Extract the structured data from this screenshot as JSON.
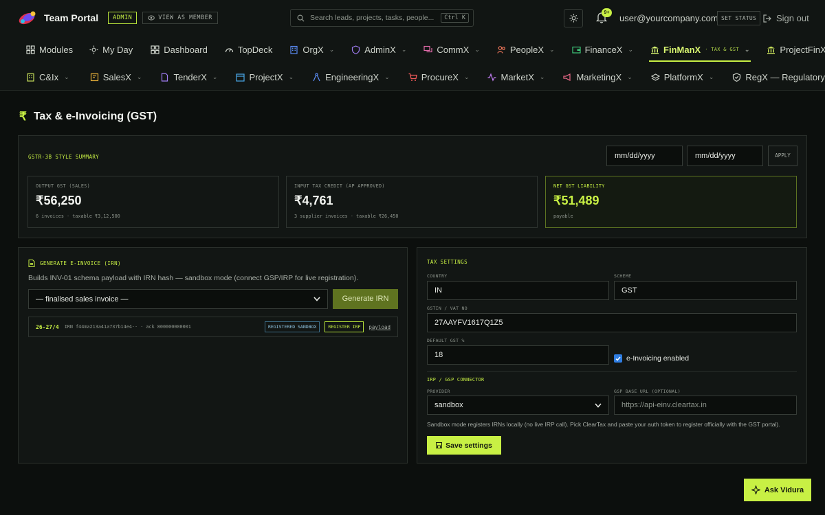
{
  "header": {
    "brand_name": "Team Portal",
    "admin_badge": "ADMIN",
    "view_as_member": "VIEW AS MEMBER",
    "search_placeholder": "Search leads, projects, tasks, people...",
    "search_shortcut": "Ctrl K",
    "notification_count": "9+",
    "user_email": "user@yourcompany.com",
    "set_status": "SET STATUS",
    "sign_out": "Sign out"
  },
  "nav_primary": [
    {
      "label": "Modules",
      "icon": "grid-icon"
    },
    {
      "label": "My Day",
      "icon": "sun-icon"
    },
    {
      "label": "Dashboard",
      "icon": "grid-icon"
    },
    {
      "label": "TopDeck",
      "icon": "gauge-icon"
    },
    {
      "label": "OrgX",
      "icon": "building-icon"
    },
    {
      "label": "AdminX",
      "icon": "shield-icon"
    },
    {
      "label": "CommX",
      "icon": "chat-icon"
    },
    {
      "label": "PeopleX",
      "icon": "people-icon"
    },
    {
      "label": "FinanceX",
      "icon": "wallet-icon"
    },
    {
      "label": "FinManX",
      "sub": "· TAX & GST",
      "icon": "bank-icon",
      "active": true
    },
    {
      "label": "ProjectFinX",
      "icon": "bank-icon"
    }
  ],
  "nav_secondary": [
    {
      "label": "C&Ix",
      "icon": "building-icon"
    },
    {
      "label": "SalesX",
      "icon": "tag-icon"
    },
    {
      "label": "TenderX",
      "icon": "file-icon"
    },
    {
      "label": "ProjectX",
      "icon": "calendar-icon"
    },
    {
      "label": "EngineeringX",
      "icon": "compass-icon"
    },
    {
      "label": "ProcureX",
      "icon": "cart-icon"
    },
    {
      "label": "MarketX",
      "icon": "pulse-icon"
    },
    {
      "label": "MarketingX",
      "icon": "megaphone-icon"
    },
    {
      "label": "PlatformX",
      "icon": "layers-icon"
    },
    {
      "label": "RegX — Regulatory",
      "icon": "shield-icon"
    }
  ],
  "page": {
    "title": "Tax & e-Invoicing (GST)",
    "title_icon": "rupee-icon"
  },
  "summary": {
    "heading": "GSTR-3B STYLE SUMMARY",
    "from_date": "mm/dd/yyyy",
    "to_date": "mm/dd/yyyy",
    "apply": "APPLY",
    "cards": [
      {
        "label": "OUTPUT GST (SALES)",
        "amount": "₹56,250",
        "sub": "6 invoices · taxable ₹3,12,500"
      },
      {
        "label": "INPUT TAX CREDIT (AP APPROVED)",
        "amount": "₹4,761",
        "sub": "3 supplier invoices · taxable ₹26,450"
      },
      {
        "label": "NET GST LIABILITY",
        "amount": "₹51,489",
        "sub": "payable"
      }
    ]
  },
  "irn": {
    "heading": "GENERATE E-INVOICE (IRN)",
    "description": "Builds INV-01 schema payload with IRN hash — sandbox mode (connect GSP/IRP for live registration).",
    "select_value": "— finalised sales invoice —",
    "generate_button": "Generate IRN",
    "rows": [
      {
        "invoice": "26-27/4",
        "meta": "IRN f44ma213a41a737b14e4·· · ack 800000000001",
        "status": "REGISTERED SANDBOX",
        "register": "REGISTER IRP",
        "payload": "payload"
      }
    ]
  },
  "settings": {
    "heading": "TAX SETTINGS",
    "country_label": "COUNTRY",
    "country_value": "IN",
    "scheme_label": "SCHEME",
    "scheme_value": "GST",
    "gstin_label": "GSTIN / VAT NO",
    "gstin_value": "27AAYFV1617Q1Z5",
    "default_gst_label": "DEFAULT GST %",
    "default_gst_value": "18",
    "einvoicing_label": "e-Invoicing enabled",
    "einvoicing_enabled": true,
    "connector_heading": "IRP / GSP CONNECTOR",
    "provider_label": "PROVIDER",
    "provider_value": "sandbox",
    "gsp_url_label": "GSP BASE URL (OPTIONAL)",
    "gsp_url_placeholder": "https://api-einv.cleartax.in",
    "help_text": "Sandbox mode registers IRNs locally (no live IRP call). Pick ClearTax and paste your auth token to register officially with the GST portal).",
    "save_button": "Save settings"
  },
  "assistant": {
    "label": "Ask Vidura"
  },
  "colors": {
    "accent": "#c8f044",
    "background": "#0c0f0d",
    "panel": "#121614"
  }
}
